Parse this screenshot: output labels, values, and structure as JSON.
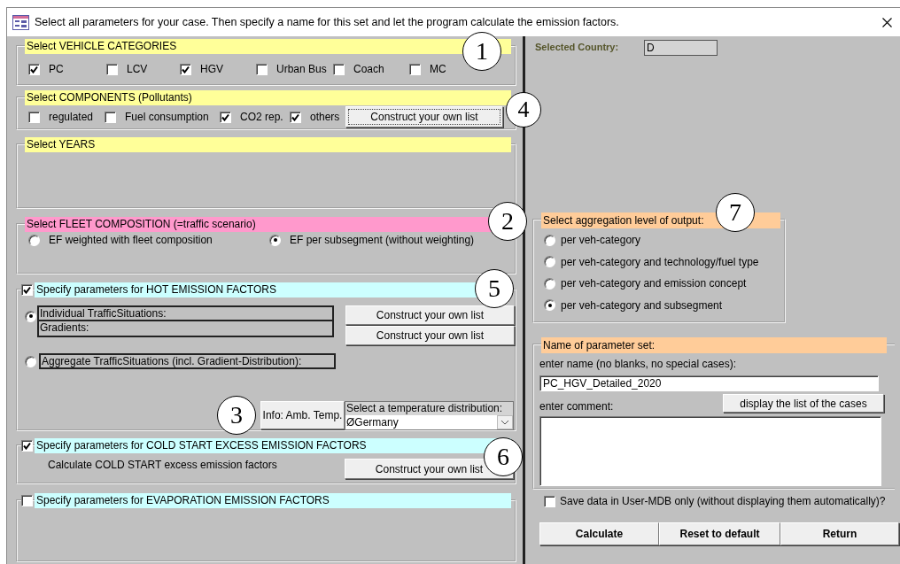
{
  "window": {
    "title": "Select all parameters for your case. Then specify a name for this set and let the program calculate the emission factors."
  },
  "vehicle_categories": {
    "title": "Select VEHICLE CATEGORIES",
    "callout": "1",
    "items": [
      {
        "label": "PC",
        "checked": true
      },
      {
        "label": "LCV",
        "checked": false
      },
      {
        "label": "HGV",
        "checked": true
      },
      {
        "label": "Urban Bus",
        "checked": false
      },
      {
        "label": "Coach",
        "checked": false
      },
      {
        "label": "MC",
        "checked": false
      }
    ]
  },
  "components": {
    "title": "Select COMPONENTS (Pollutants)",
    "callout": "4",
    "items": [
      {
        "label": "regulated",
        "checked": false
      },
      {
        "label": "Fuel consumption",
        "checked": false
      },
      {
        "label": "CO2 rep.",
        "checked": true
      },
      {
        "label": "others",
        "checked": true
      }
    ],
    "button": "Construct your own list"
  },
  "years": {
    "title": "Select YEARS"
  },
  "fleet_composition": {
    "title": "Select FLEET COMPOSITION (=traffic scenario)",
    "callout": "2",
    "options": [
      {
        "label": "EF weighted with fleet composition",
        "selected": false
      },
      {
        "label": "EF per subsegment (without weighting)",
        "selected": true
      }
    ]
  },
  "hot_emission": {
    "title": "Specify parameters for HOT EMISSION FACTORS",
    "checked": true,
    "callout": "5",
    "individual": {
      "label": "Individual TrafficSituations:",
      "sub_label": "Gradients:",
      "selected": true,
      "buttons": [
        "Construct your own list",
        "Construct your own list"
      ]
    },
    "aggregate": {
      "label": "Aggregate TrafficSituations (incl. Gradient-Distribution):",
      "selected": false
    },
    "temperature": {
      "callout": "3",
      "info_button": "Info: Amb. Temp.",
      "label": "Select a temperature distribution:",
      "value": "ØGermany"
    }
  },
  "cold_start": {
    "title": "Specify parameters for COLD START EXCESS EMISSION FACTORS",
    "checked": true,
    "callout": "6",
    "text": "Calculate COLD START excess emission factors",
    "button": "Construct your own list"
  },
  "evaporation": {
    "title": "Specify parameters for EVAPORATION EMISSION FACTORS",
    "checked": false
  },
  "country": {
    "label": "Selected Country:",
    "value": "D"
  },
  "aggregation": {
    "title": "Select aggregation level of output:",
    "callout": "7",
    "options": [
      {
        "label": "per veh-category",
        "selected": false
      },
      {
        "label": "per veh-category and technology/fuel type",
        "selected": false
      },
      {
        "label": "per veh-category and emission concept",
        "selected": false
      },
      {
        "label": "per veh-category and subsegment",
        "selected": true
      }
    ]
  },
  "parameter_set": {
    "title": "Name of parameter set:",
    "name_label": "enter name (no blanks, no special cases):",
    "name_value": "PC_HGV_Detailed_2020",
    "comment_label": "enter comment:",
    "list_button": "display the list of the cases"
  },
  "save_only": {
    "label": "Save data in User-MDB only (without displaying them automatically)?",
    "checked": false
  },
  "buttons": [
    "Calculate",
    "Reset to default",
    "Return"
  ]
}
